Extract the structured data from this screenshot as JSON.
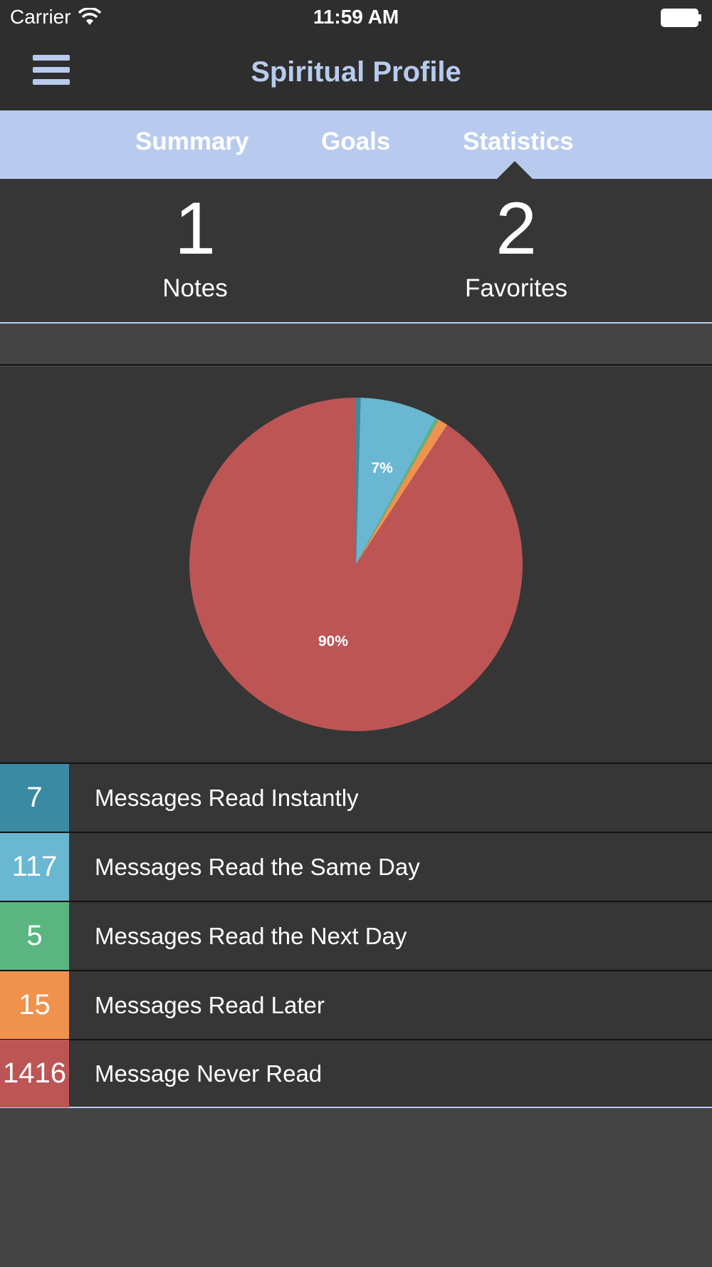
{
  "status_bar": {
    "carrier": "Carrier",
    "time": "11:59 AM"
  },
  "nav": {
    "title": "Spiritual Profile",
    "menu_icon": "hamburger-menu-icon"
  },
  "tabs": [
    {
      "label": "Summary",
      "active": false
    },
    {
      "label": "Goals",
      "active": false
    },
    {
      "label": "Statistics",
      "active": true
    }
  ],
  "counts": {
    "notes": {
      "value": "1",
      "label": "Notes"
    },
    "favorites": {
      "value": "2",
      "label": "Favorites"
    }
  },
  "chart_data": {
    "type": "pie",
    "slices": [
      {
        "label": "Messages Read Instantly",
        "value": 7,
        "color": "#3a8aa3",
        "pct_label": ""
      },
      {
        "label": "Messages Read the Same Day",
        "value": 117,
        "color": "#6ab7d1",
        "pct_label": "7%"
      },
      {
        "label": "Messages Read the Next Day",
        "value": 5,
        "color": "#5bb580",
        "pct_label": ""
      },
      {
        "label": "Messages Read Later",
        "value": 15,
        "color": "#ef924e",
        "pct_label": ""
      },
      {
        "label": "Message Never Read",
        "value": 1416,
        "color": "#bd5555",
        "pct_label": "90%"
      }
    ]
  },
  "legend": [
    {
      "count": "7",
      "label": "Messages Read Instantly",
      "color": "#3a8aa3"
    },
    {
      "count": "117",
      "label": "Messages Read the Same Day",
      "color": "#6ab7d1"
    },
    {
      "count": "5",
      "label": "Messages Read the Next Day",
      "color": "#5bb580"
    },
    {
      "count": "15",
      "label": "Messages Read Later",
      "color": "#ef924e"
    },
    {
      "count": "1416",
      "label": "Message Never Read",
      "color": "#bd5555"
    }
  ],
  "colors": {
    "accent": "#b8cbef",
    "bar": "#2e2e2e",
    "panel": "#363636",
    "background": "#444444"
  }
}
